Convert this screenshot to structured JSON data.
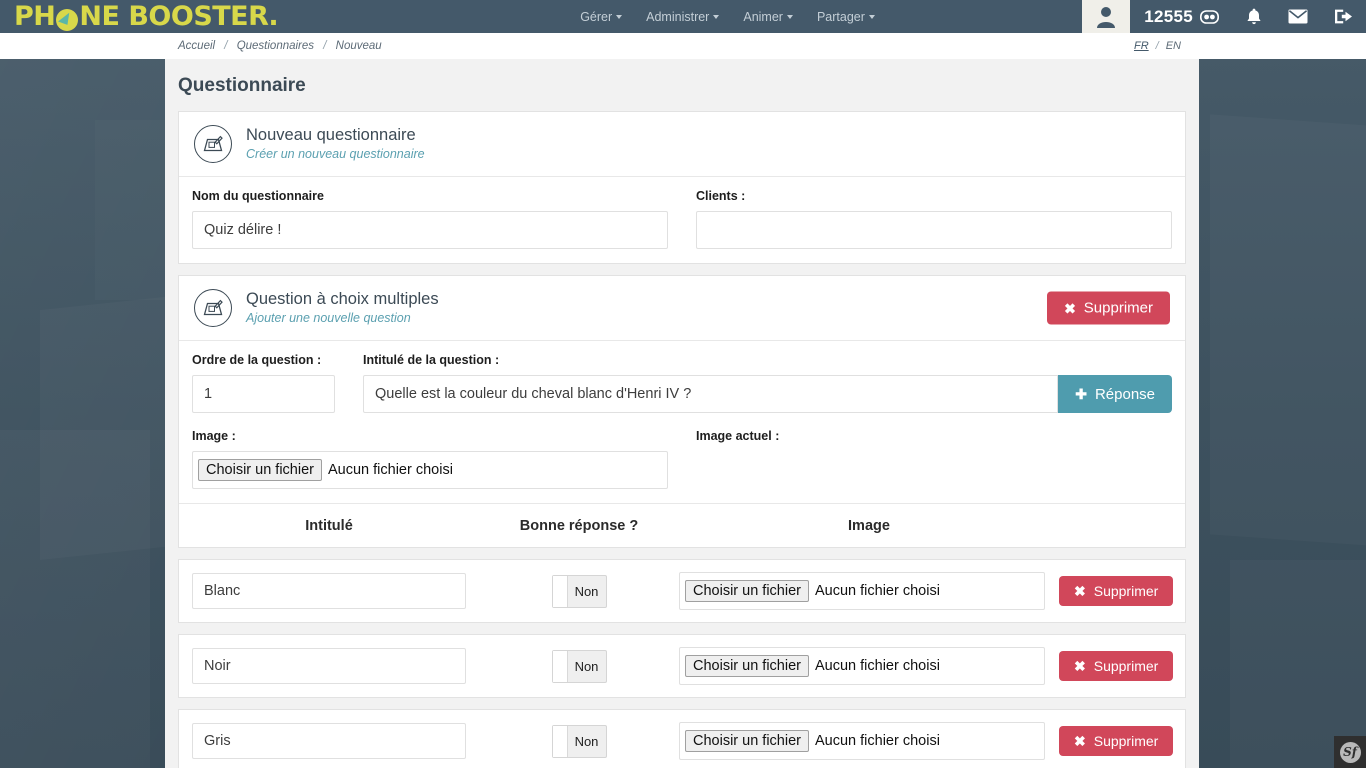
{
  "topbar": {
    "logo_text_1": "PH",
    "logo_text_2": "NE BOOSTER",
    "logo_period": ".",
    "nav": [
      {
        "label": "Gérer"
      },
      {
        "label": "Administrer"
      },
      {
        "label": "Animer"
      },
      {
        "label": "Partager"
      }
    ],
    "credits": "12555",
    "icons": {
      "avatar": "avatar-icon",
      "coins": "coins-icon",
      "bell": "bell-icon",
      "mail": "envelope-icon",
      "logout": "logout-icon"
    },
    "colors": {
      "bar": "#44596a",
      "logo_yellow": "#d8d84a",
      "accent_teal": "#4f9cae",
      "danger_red": "#d1475a"
    }
  },
  "breadcrumb": {
    "items": [
      "Accueil",
      "Questionnaires",
      "Nouveau"
    ],
    "separator": "/"
  },
  "language": {
    "options": [
      "FR",
      "EN"
    ],
    "selected": "FR",
    "separator": "/"
  },
  "page": {
    "title": "Questionnaire"
  },
  "questionnaire_panel": {
    "title": "Nouveau questionnaire",
    "subtitle": "Créer un nouveau questionnaire",
    "name_label": "Nom du questionnaire",
    "name_value": "Quiz délire !",
    "name_placeholder": "",
    "clients_label": "Clients :",
    "clients_value": "",
    "clients_placeholder": ""
  },
  "question_panel": {
    "title": "Question à choix multiples",
    "subtitle": "Ajouter une nouvelle question",
    "delete_label": "Supprimer",
    "order_label": "Ordre de la question :",
    "order_value": "1",
    "title_label": "Intitulé de la question :",
    "title_value": "Quelle est la couleur du cheval blanc d'Henri IV ?",
    "add_answer_label": "Réponse",
    "image_label": "Image :",
    "image_button": "Choisir un fichier",
    "image_filename": "Aucun fichier choisi",
    "current_image_label": "Image actuel :"
  },
  "answers": {
    "columns": [
      "Intitulé",
      "Bonne réponse ?",
      "Image"
    ],
    "file_button": "Choisir un fichier",
    "file_placeholder": "Aucun fichier choisi",
    "delete_label": "Supprimer",
    "rows": [
      {
        "intitule": "Blanc",
        "bonne_reponse": "Non",
        "file_button": "Choisir un fichier",
        "file_name": "Aucun fichier choisi",
        "delete_label": "Supprimer"
      },
      {
        "intitule": "Noir",
        "bonne_reponse": "Non",
        "file_button": "Choisir un fichier",
        "file_name": "Aucun fichier choisi",
        "delete_label": "Supprimer"
      },
      {
        "intitule": "Gris",
        "bonne_reponse": "Non",
        "file_button": "Choisir un fichier",
        "file_name": "Aucun fichier choisi",
        "delete_label": "Supprimer"
      }
    ]
  },
  "debug_toolbar": {
    "label": "Sf"
  }
}
